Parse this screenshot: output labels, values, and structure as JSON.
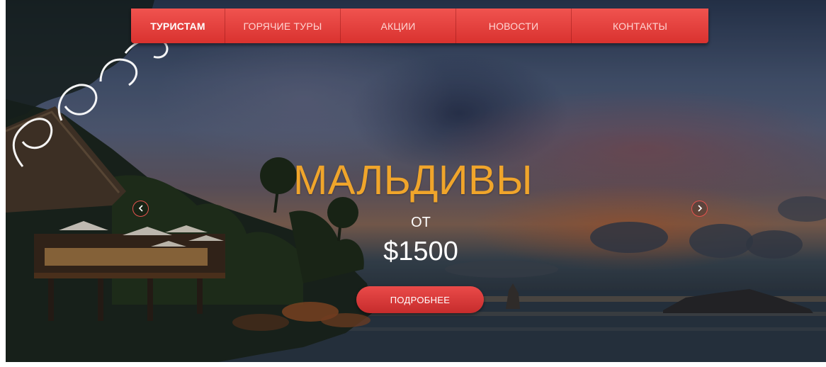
{
  "nav": {
    "items": [
      {
        "label": "ТУРИСТАМ",
        "active": true
      },
      {
        "label": "ГОРЯЧИЕ ТУРЫ",
        "active": false
      },
      {
        "label": "АКЦИИ",
        "active": false
      },
      {
        "label": "НОВОСТИ",
        "active": false
      },
      {
        "label": "КОНТАКТЫ",
        "active": false
      }
    ]
  },
  "slide": {
    "title": "МАЛЬДИВЫ",
    "from_label": "ОТ",
    "price": "$1500",
    "button_label": "ПОДРОБНЕЕ"
  },
  "controls": {
    "prev_icon": "chevron-left-icon",
    "next_icon": "chevron-right-icon"
  },
  "colors": {
    "nav_red": "#e4423f",
    "title_orange": "#f0a52b",
    "button_red": "#d93a3a"
  }
}
